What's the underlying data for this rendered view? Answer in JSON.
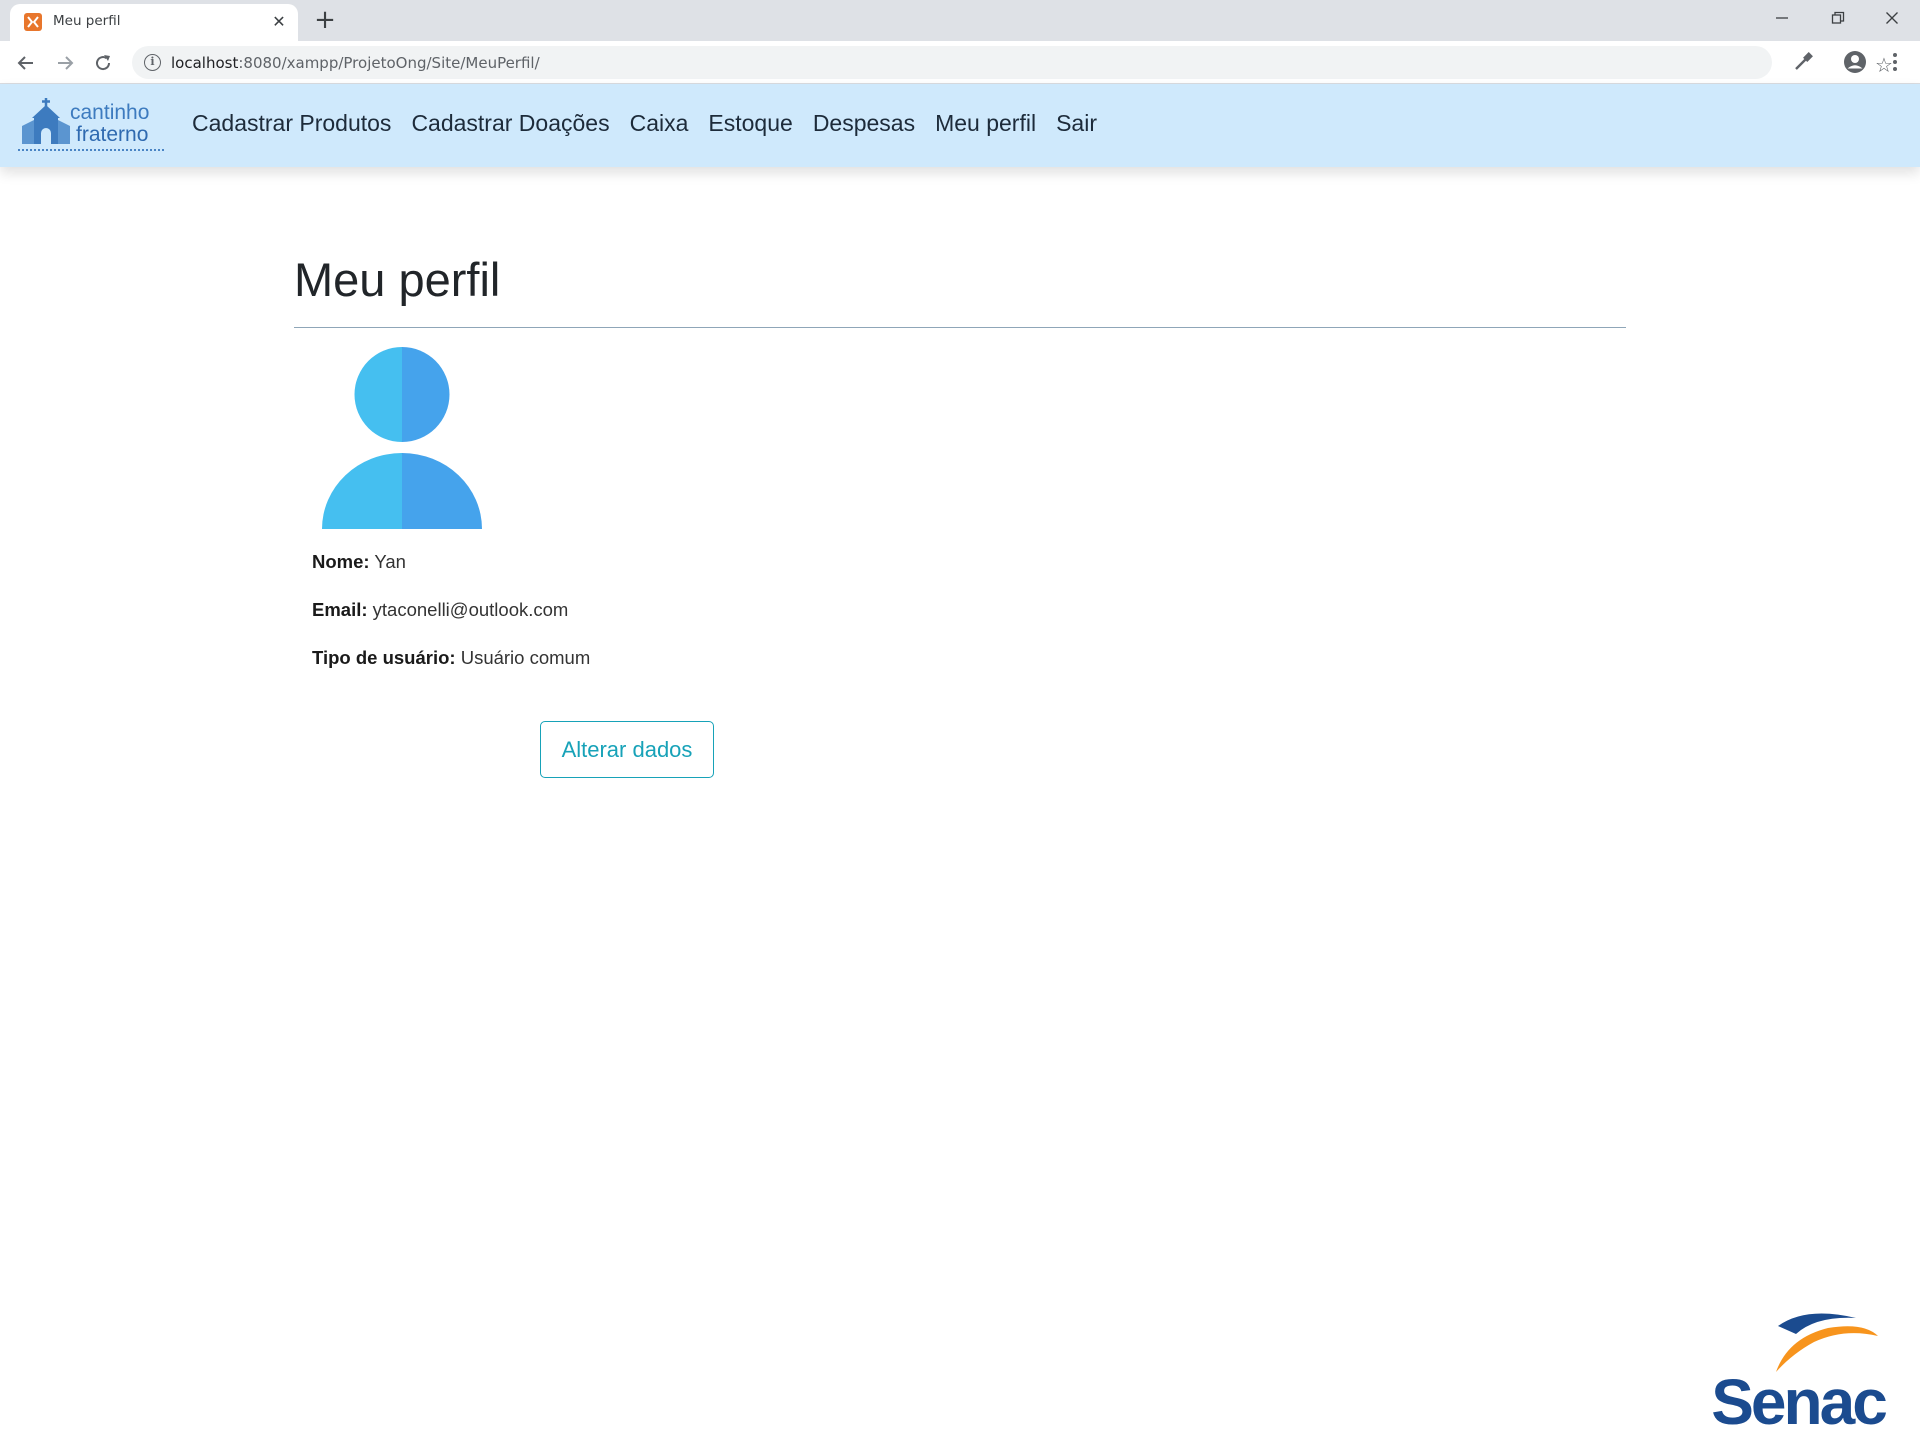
{
  "browser": {
    "tab_title": "Meu perfil",
    "tab_close": "✕",
    "new_tab": "+",
    "url_host": "localhost",
    "url_path": ":8080/xampp/ProjetoOng/Site/MeuPerfil/",
    "omnibox_info": "i"
  },
  "navbar": {
    "logo_line1": "cantinho",
    "logo_line2": "fraterno",
    "links": [
      "Cadastrar Produtos",
      "Cadastrar Doações",
      "Caixa",
      "Estoque",
      "Despesas",
      "Meu perfil",
      "Sair"
    ]
  },
  "profile": {
    "page_title": "Meu perfil",
    "name_label": "Nome:",
    "name_value": "Yan",
    "email_label": "Email:",
    "email_value": "ytaconelli@outlook.com",
    "type_label": "Tipo de usuário:",
    "type_value": "Usuário comum",
    "edit_button": "Alterar dados"
  },
  "footer": {
    "brand_logo": "Senac"
  },
  "colors": {
    "navbar_bg": "#cfe9fc",
    "avatar_light": "#45bff0",
    "avatar_dark": "#45a3ec",
    "button_accent": "#17a2b8",
    "senac_blue": "#1b4b8f",
    "senac_orange": "#f7941d"
  }
}
